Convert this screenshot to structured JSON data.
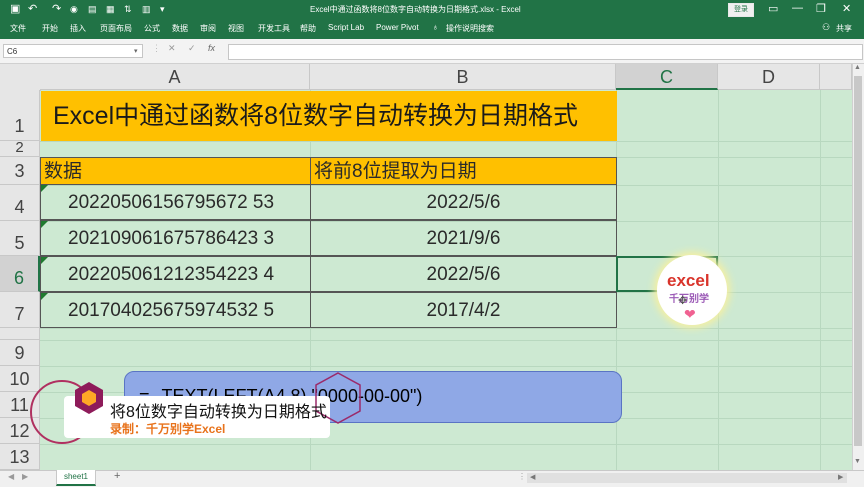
{
  "window": {
    "title": "Excel中通过函数将8位数字自动转换为日期格式.xlsx  -  Excel",
    "login_label": "登录",
    "min_icon": "—",
    "max_icon": "❐",
    "close_icon": "✕",
    "layout_icon": "▭"
  },
  "ribbon": {
    "tabs": [
      "文件",
      "开始",
      "插入",
      "页面布局",
      "公式",
      "数据",
      "审阅",
      "视图",
      "开发工具",
      "帮助",
      "Script Lab",
      "Power Pivot"
    ],
    "tell_me": "操作说明搜索",
    "share": "共享"
  },
  "formula_bar": {
    "name_box": "C6",
    "formula": "",
    "cancel_icon": "✕",
    "enter_icon": "✓",
    "fx_label": "fx"
  },
  "columns": [
    "A",
    "B",
    "C",
    "D"
  ],
  "rows": [
    "1",
    "2",
    "3",
    "4",
    "5",
    "6",
    "7",
    "8",
    "9",
    "10",
    "11",
    "12",
    "13"
  ],
  "sheet": {
    "title": "Excel中通过函数将8位数字自动转换为日期格式",
    "headers": [
      "数据",
      "将前8位提取为日期"
    ],
    "data": [
      [
        "20220506156795672 53",
        "2022/5/6"
      ],
      [
        "202109061675786423 3",
        "2021/9/6"
      ],
      [
        "202205061212354223 4",
        "2022/5/6"
      ],
      [
        "201704025675974532 5",
        "2017/4/2"
      ]
    ],
    "formula_text": "=--TEXT(LEFT(A4,8),\"0000-00-00\")"
  },
  "overlay": {
    "banner_title": "将8位数字自动转换为日期格式",
    "banner_sub": "录制：千万别学Excel",
    "logo_top": "excel",
    "logo_bottom": "千万别学"
  },
  "tabs_bar": {
    "sheet_name": "sheet1",
    "add_icon": "+"
  },
  "colors": {
    "accent": "#217346",
    "header_fill": "#ffc000",
    "sheet_bg": "#cde9d2",
    "formula_box": "#8fa8e6"
  }
}
